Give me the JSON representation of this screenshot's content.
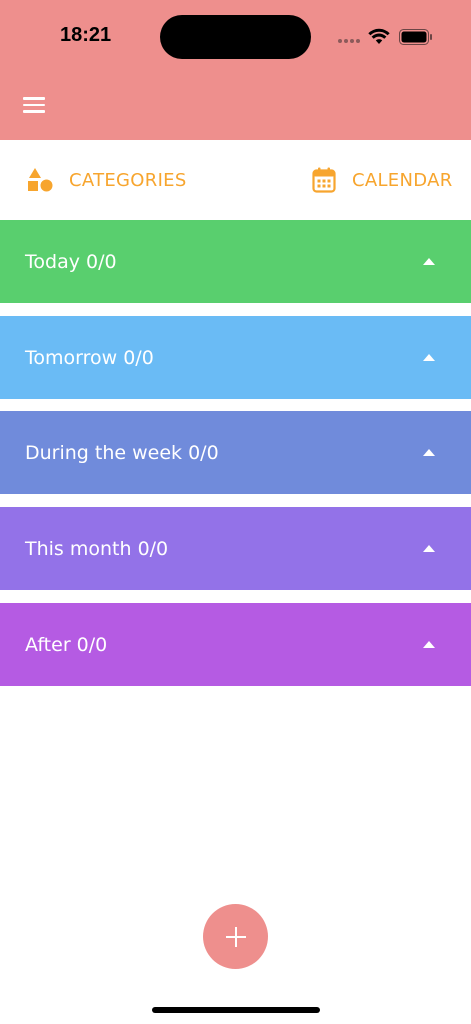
{
  "status_bar": {
    "time": "18:21"
  },
  "header": {
    "menu_icon": "hamburger-menu-icon"
  },
  "tabs": {
    "categories": {
      "label": "CATEGORIES",
      "icon": "shapes-icon"
    },
    "calendar": {
      "label": "CALENDAR",
      "icon": "calendar-icon"
    }
  },
  "sections": [
    {
      "title": "Today 0/0",
      "color": "#59cf6e"
    },
    {
      "title": "Tomorrow 0/0",
      "color": "#6abbf5"
    },
    {
      "title": "During the week 0/0",
      "color": "#708bdb"
    },
    {
      "title": "This month 0/0",
      "color": "#9372e8"
    },
    {
      "title": "After 0/0",
      "color": "#b55be3"
    }
  ],
  "fab": {
    "icon": "plus-icon"
  },
  "colors": {
    "header": "#ee8f8d",
    "accent": "#f7a52e"
  }
}
